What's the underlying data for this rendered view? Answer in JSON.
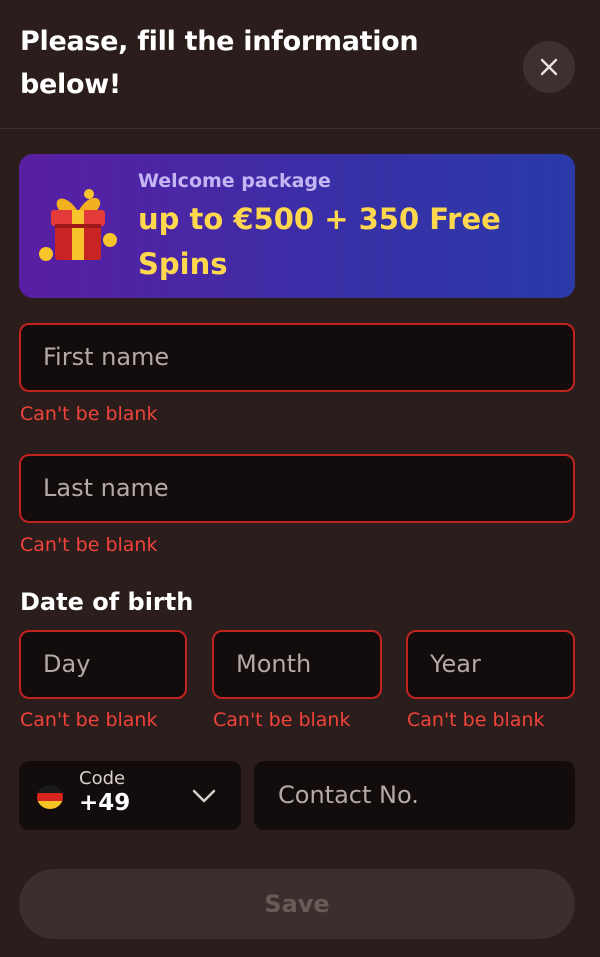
{
  "header": {
    "title": "Please, fill the information below!",
    "close_icon": "close-icon"
  },
  "promo": {
    "subtitle": "Welcome package",
    "headline": "up to €500 + 350 Free Spins",
    "icon": "gift-box-icon"
  },
  "form": {
    "first_name": {
      "placeholder": "First name",
      "error": "Can't be blank"
    },
    "last_name": {
      "placeholder": "Last name",
      "error": "Can't be blank"
    },
    "dob": {
      "label": "Date of birth",
      "day": {
        "placeholder": "Day",
        "error": "Can't be blank"
      },
      "month": {
        "placeholder": "Month",
        "error": "Can't be blank"
      },
      "year": {
        "placeholder": "Year",
        "error": "Can't be blank"
      }
    },
    "phone": {
      "code_label": "Code",
      "code_value": "+49",
      "flag_icon": "germany-flag-icon",
      "chevron_icon": "chevron-down-icon",
      "contact_placeholder": "Contact No."
    },
    "save_label": "Save"
  },
  "colors": {
    "background": "#2a1d1c",
    "field_bg": "#120d0c",
    "error": "#f0433a",
    "error_border": "#c3231f",
    "promo_headline": "#ffd84d",
    "promo_gradient_start": "#5a1ea3",
    "promo_gradient_end": "#2a3aa8"
  }
}
